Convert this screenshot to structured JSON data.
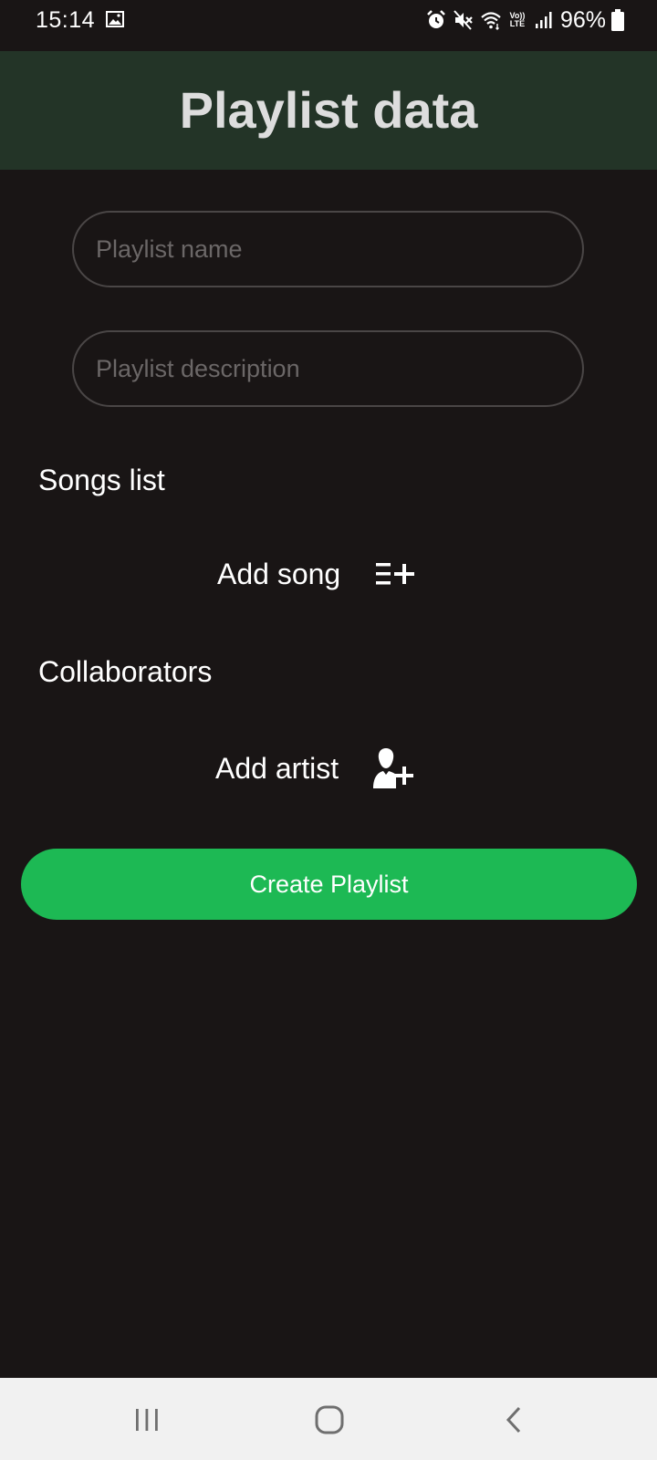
{
  "status_bar": {
    "time": "15:14",
    "battery": "96%",
    "lte_line1": "Vo))",
    "lte_line2": "LTE",
    "icons": [
      "gallery-icon",
      "alarm-icon",
      "mute-icon",
      "wifi-icon",
      "volte-icon",
      "signal-icon",
      "battery-icon"
    ]
  },
  "header": {
    "title": "Playlist data",
    "background": "#233427"
  },
  "form": {
    "name_placeholder": "Playlist name",
    "name_value": "",
    "description_placeholder": "Playlist description",
    "description_value": ""
  },
  "songs": {
    "section_label": "Songs list",
    "add_label": "Add song",
    "add_icon": "playlist-add-icon"
  },
  "collaborators": {
    "section_label": "Collaborators",
    "add_label": "Add artist",
    "add_icon": "person-add-icon"
  },
  "actions": {
    "create_label": "Create Playlist",
    "create_color": "#1db954"
  },
  "nav": {
    "recents_icon": "recents-icon",
    "home_icon": "home-icon",
    "back_icon": "back-icon"
  },
  "colors": {
    "background": "#191515",
    "accent": "#1db954",
    "header": "#233427"
  }
}
